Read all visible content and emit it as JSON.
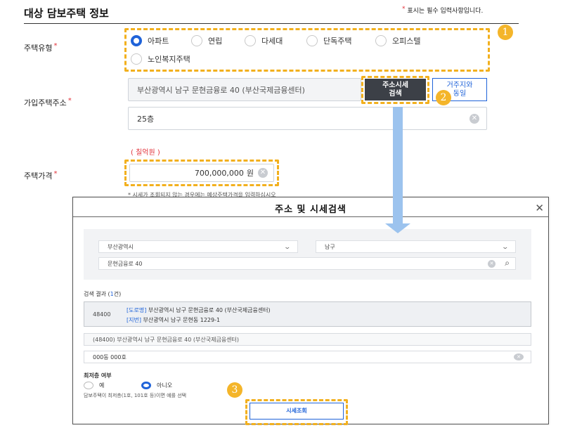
{
  "header": {
    "title": "대상 담보주택 정보",
    "required_star": "*",
    "required_note": "표시는 필수 입력사항입니다."
  },
  "house_type": {
    "label": "주택유형",
    "star": "*",
    "options": [
      "아파트",
      "연립",
      "다세대",
      "단독주택",
      "오피스텔",
      "노인복지주택"
    ],
    "selected": "아파트",
    "badge": "1"
  },
  "address": {
    "label": "가입주택주소",
    "star": "*",
    "value": "부산광역시 남구 문현금융로 40 (부산국제금융센터)",
    "search_btn_line1": "주소시세",
    "search_btn_line2": "검색",
    "same_btn_line1": "거주지와",
    "same_btn_line2": "동일",
    "detail_value": "25층",
    "badge": "2"
  },
  "price": {
    "hangul_amount": "( 칠억원 )",
    "label": "주택가격",
    "star": "*",
    "value": "700,000,000",
    "unit": "원",
    "note": "* 시세가 조회되지 않는 경우에는 예상주택가격을 입력하십시오"
  },
  "modal": {
    "title": "주소 및 시세검색",
    "close": "✕",
    "sido": "부산광역시",
    "sigungu": "남구",
    "road_query": "문현금융로 40",
    "result_label": "검색 결과",
    "result_count_prefix": "(",
    "result_count": "1",
    "result_count_suffix": "건)",
    "result": {
      "zip": "48400",
      "road_tag": "[도로명]",
      "road_addr": "부산광역시 남구 문현금융로 40 (부산국제금융센터)",
      "jibun_tag": "[지번]",
      "jibun_addr": "부산광역시 남구 문현동 1229-1"
    },
    "selected_addr": "(48400) 부산광역시 남구 문현금융로 40 (부산국제금융센터)",
    "unit_value": "000동 000호",
    "lowest_floor_label": "최저층 여부",
    "yes_label": "예",
    "no_label": "아니오",
    "lowest_floor_selected": "아니오",
    "hint": "담보주택이 최저층(1호, 101호 등)이면 예를 선택",
    "search_button": "시세조회",
    "badge": "3"
  },
  "colors": {
    "accent": "#1f63d9",
    "highlight": "#f2b01e",
    "required": "#e2333b"
  }
}
